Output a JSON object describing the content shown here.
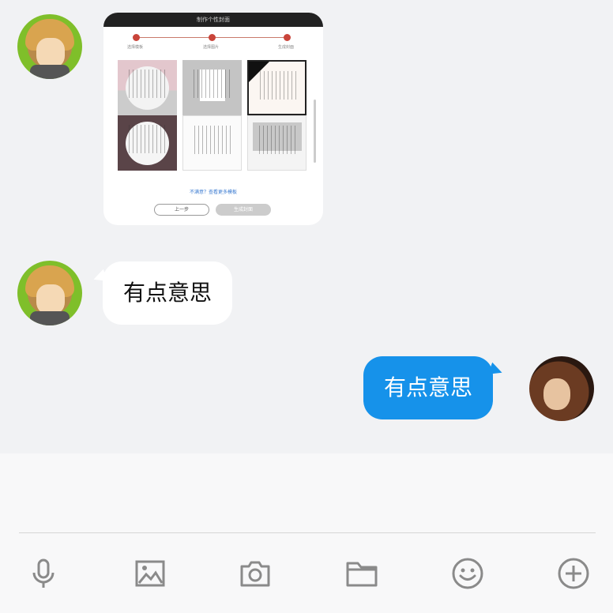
{
  "card": {
    "header_title": "制作个性封面",
    "steps": [
      "选择模板",
      "选择图片",
      "生成封面"
    ],
    "link_text": "不满意？查看更多模板",
    "button_left": "上一步",
    "button_right": "生成封面"
  },
  "messages": [
    {
      "side": "in",
      "text": "有点意思"
    },
    {
      "side": "out",
      "text": "有点意思"
    }
  ],
  "toolbar": {
    "icons": [
      "microphone-icon",
      "image-icon",
      "camera-icon",
      "folder-icon",
      "emoji-icon",
      "plus-icon"
    ]
  },
  "colors": {
    "background": "#f1f2f4",
    "outgoing_bubble": "#1692ea",
    "incoming_bubble": "#ffffff",
    "icon": "#8a8a8a"
  }
}
